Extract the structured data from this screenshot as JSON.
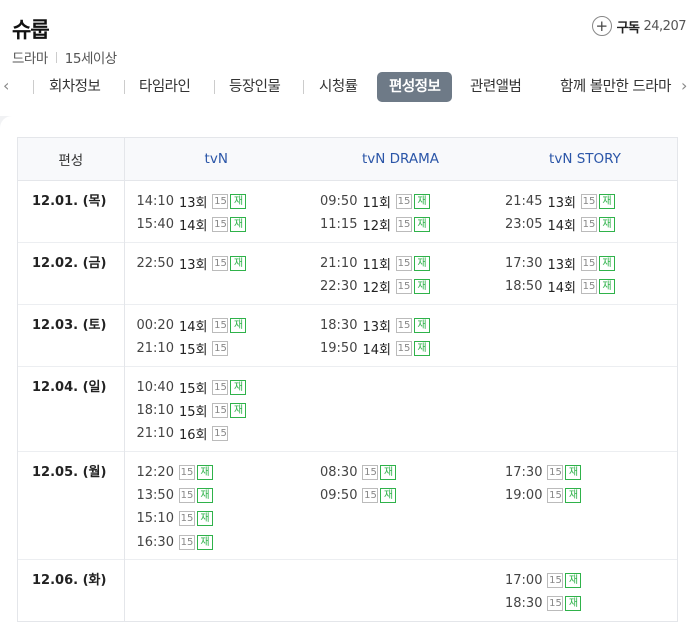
{
  "header": {
    "title": "슈룹",
    "genre": "드라마",
    "age": "15세이상",
    "subscribe_icon": "plus-icon",
    "subscribe_label": "구독",
    "subscribe_count": "24,207"
  },
  "tabs": {
    "prev_icon": "chevron-left-icon",
    "next_icon": "chevron-right-icon",
    "items": [
      {
        "label": "회차정보"
      },
      {
        "label": "타임라인"
      },
      {
        "label": "등장인물"
      },
      {
        "label": "시청률"
      },
      {
        "label": "편성정보",
        "active": true
      },
      {
        "label": "관련앨범"
      },
      {
        "label": "함께 볼만한 드라마"
      }
    ]
  },
  "schedule": {
    "header_date": "편성",
    "channels": [
      "tvN",
      "tvN DRAMA",
      "tvN STORY"
    ],
    "rating_label": "15",
    "rerun_label": "재",
    "rerun_color": "#2fb24a",
    "channel_color": "#2b56a8",
    "rows": [
      {
        "date": "12.01. (목)",
        "cells": [
          [
            {
              "time": "14:10",
              "ep": "13회",
              "rerun": true
            },
            {
              "time": "15:40",
              "ep": "14회",
              "rerun": true
            }
          ],
          [
            {
              "time": "09:50",
              "ep": "11회",
              "rerun": true
            },
            {
              "time": "11:15",
              "ep": "12회",
              "rerun": true
            }
          ],
          [
            {
              "time": "21:45",
              "ep": "13회",
              "rerun": true
            },
            {
              "time": "23:05",
              "ep": "14회",
              "rerun": true
            }
          ]
        ]
      },
      {
        "date": "12.02. (금)",
        "cells": [
          [
            {
              "time": "22:50",
              "ep": "13회",
              "rerun": true
            }
          ],
          [
            {
              "time": "21:10",
              "ep": "11회",
              "rerun": true
            },
            {
              "time": "22:30",
              "ep": "12회",
              "rerun": true
            }
          ],
          [
            {
              "time": "17:30",
              "ep": "13회",
              "rerun": true
            },
            {
              "time": "18:50",
              "ep": "14회",
              "rerun": true
            }
          ]
        ]
      },
      {
        "date": "12.03. (토)",
        "cells": [
          [
            {
              "time": "00:20",
              "ep": "14회",
              "rerun": true
            },
            {
              "time": "21:10",
              "ep": "15회",
              "rerun": false
            }
          ],
          [
            {
              "time": "18:30",
              "ep": "13회",
              "rerun": true
            },
            {
              "time": "19:50",
              "ep": "14회",
              "rerun": true
            }
          ],
          []
        ]
      },
      {
        "date": "12.04. (일)",
        "cells": [
          [
            {
              "time": "10:40",
              "ep": "15회",
              "rerun": true
            },
            {
              "time": "18:10",
              "ep": "15회",
              "rerun": true
            },
            {
              "time": "21:10",
              "ep": "16회",
              "rerun": false
            }
          ],
          [],
          []
        ]
      },
      {
        "date": "12.05. (월)",
        "cells": [
          [
            {
              "time": "12:20",
              "ep": "",
              "rerun": true
            },
            {
              "time": "13:50",
              "ep": "",
              "rerun": true
            },
            {
              "time": "15:10",
              "ep": "",
              "rerun": true
            },
            {
              "time": "16:30",
              "ep": "",
              "rerun": true
            }
          ],
          [
            {
              "time": "08:30",
              "ep": "",
              "rerun": true
            },
            {
              "time": "09:50",
              "ep": "",
              "rerun": true
            }
          ],
          [
            {
              "time": "17:30",
              "ep": "",
              "rerun": true
            },
            {
              "time": "19:00",
              "ep": "",
              "rerun": true
            }
          ]
        ]
      },
      {
        "date": "12.06. (화)",
        "cells": [
          [],
          [],
          [
            {
              "time": "17:00",
              "ep": "",
              "rerun": true
            },
            {
              "time": "18:30",
              "ep": "",
              "rerun": true
            }
          ]
        ]
      }
    ]
  }
}
